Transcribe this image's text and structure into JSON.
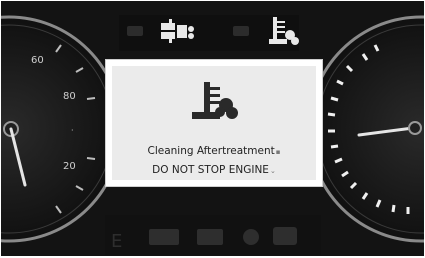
{
  "cluster": {
    "top_icons": [
      "dpf-warning-icon",
      "cleaning-aftertreatment-icon"
    ],
    "bottom_icons": [
      "fuel-e-icon",
      "warning-lights-icon"
    ]
  },
  "message": {
    "line1": "Cleaning Aftertreatment",
    "line2": "DO NOT STOP ENGINE",
    "icon": "cleaning-aftertreatment-icon"
  },
  "colors": {
    "background": "#131313",
    "message_bg": "#ffffff",
    "message_text": "#222222"
  }
}
